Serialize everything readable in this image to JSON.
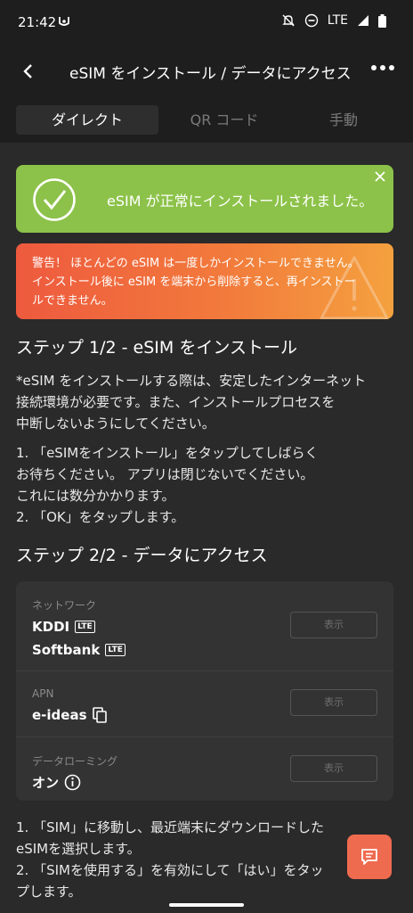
{
  "status": {
    "time": "21:42",
    "network": "LTE"
  },
  "appbar": {
    "title": "eSIM をインストール / データにアクセス"
  },
  "tabs": [
    {
      "label": "ダイレクト"
    },
    {
      "label": "QR コード"
    },
    {
      "label": "手動"
    }
  ],
  "success": {
    "message": "eSIM が正常にインストールされました。"
  },
  "warning": {
    "line1": "警告！ ほとんどの eSIM は一度しかインストールできません。",
    "line2": "インストール後に eSIM を端末から削除すると、再インストー",
    "line3": "ルできません。"
  },
  "step1": {
    "heading": "ステップ 1/2 - eSIM をインストール",
    "note1": "*eSIM をインストールする際は、安定したインターネット",
    "note2": "接続環境が必要です。また、インストールプロセスを",
    "note3": "中断しないようにしてください。",
    "item1a": "1. 「eSIMをインストール」をタップしてしばらく",
    "item1b": "お待ちください。 アプリは閉じないでください。",
    "item1c": "これには数分かかります。",
    "item2": "2. 「OK」をタップします。"
  },
  "step2": {
    "heading": "ステップ 2/2 - データにアクセス"
  },
  "card": {
    "network_label": "ネットワーク",
    "network_1": "KDDI",
    "network_2": "Softbank",
    "lte_badge": "LTE",
    "show_label": "表示",
    "apn_label": "APN",
    "apn_value": "e-ideas",
    "roaming_label": "データローミング",
    "roaming_value": "オン"
  },
  "bottom": {
    "line1": "1. 「SIM」に移動し、最近端末にダウンロードした",
    "line2": "eSIMを選択します。",
    "line3": "2. 「SIMを使用する」を有効にして「はい」をタッ",
    "line4": "プします。"
  },
  "colors": {
    "success": "#8cc249",
    "warning_start": "#ee5a3e",
    "warning_end": "#f4a13f",
    "background": "#2a2a2a",
    "chat": "#ef6b4f"
  }
}
